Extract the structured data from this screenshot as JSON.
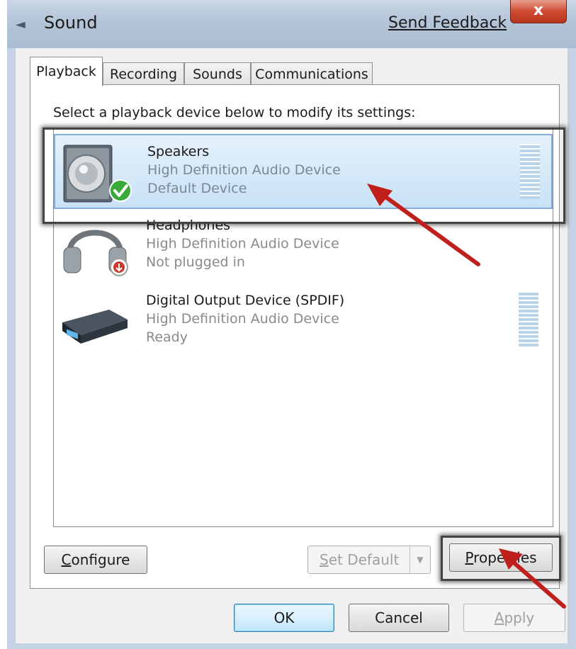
{
  "window": {
    "title": "Sound",
    "send_feedback": "Send Feedback",
    "close_label": "x"
  },
  "tabs": [
    {
      "label": "Playback",
      "active": true
    },
    {
      "label": "Recording",
      "active": false
    },
    {
      "label": "Sounds",
      "active": false
    },
    {
      "label": "Communications",
      "active": false
    }
  ],
  "playback": {
    "instruction": "Select a playback device below to modify its settings:",
    "devices": [
      {
        "name": "Speakers",
        "description": "High Definition Audio Device",
        "status": "Default Device",
        "icon": "speaker-icon",
        "selected": true
      },
      {
        "name": "Headphones",
        "description": "High Definition Audio Device",
        "status": "Not plugged in",
        "icon": "headphones-icon",
        "selected": false
      },
      {
        "name": "Digital Output Device (SPDIF)",
        "description": "High Definition Audio Device",
        "status": "Ready",
        "icon": "digital-output-icon",
        "selected": false
      }
    ]
  },
  "buttons": {
    "configure_access": "C",
    "configure_rest": "onfigure",
    "set_default_access": "S",
    "set_default_rest": "et Default",
    "properties_access": "P",
    "properties_rest": "roperties",
    "ok": "OK",
    "cancel": "Cancel",
    "apply_access": "A",
    "apply_rest": "pply"
  },
  "colors": {
    "selection_bg": "#c8e2f6",
    "arrow": "#c0201c",
    "default_check": "#39a93a"
  }
}
